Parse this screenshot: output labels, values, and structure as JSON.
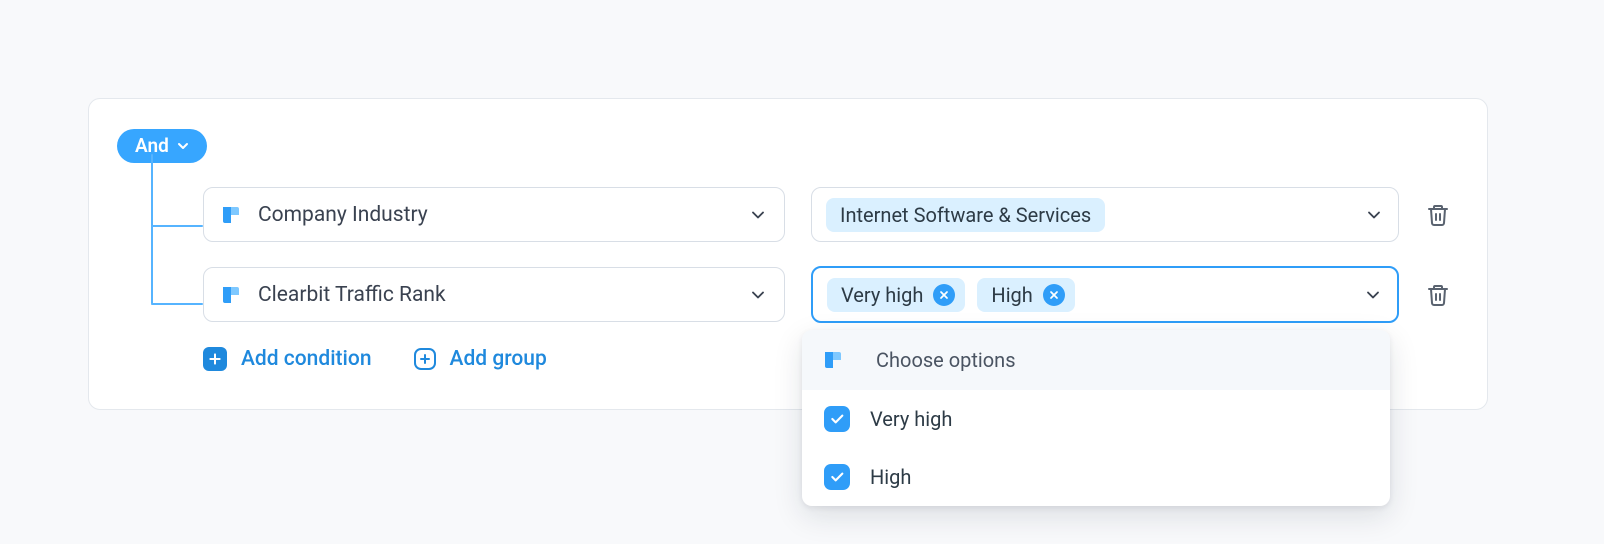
{
  "logic_operator": "And",
  "conditions": [
    {
      "field": "Company Industry",
      "values": [
        "Internet Software & Services"
      ],
      "multi_chip": false
    },
    {
      "field": "Clearbit Traffic Rank",
      "values": [
        "Very high",
        "High"
      ],
      "multi_chip": true,
      "focused": true
    }
  ],
  "actions": {
    "add_condition": "Add condition",
    "add_group": "Add group"
  },
  "dropdown": {
    "header": "Choose options",
    "options": [
      {
        "label": "Very high",
        "checked": true
      },
      {
        "label": "High",
        "checked": true
      }
    ]
  }
}
